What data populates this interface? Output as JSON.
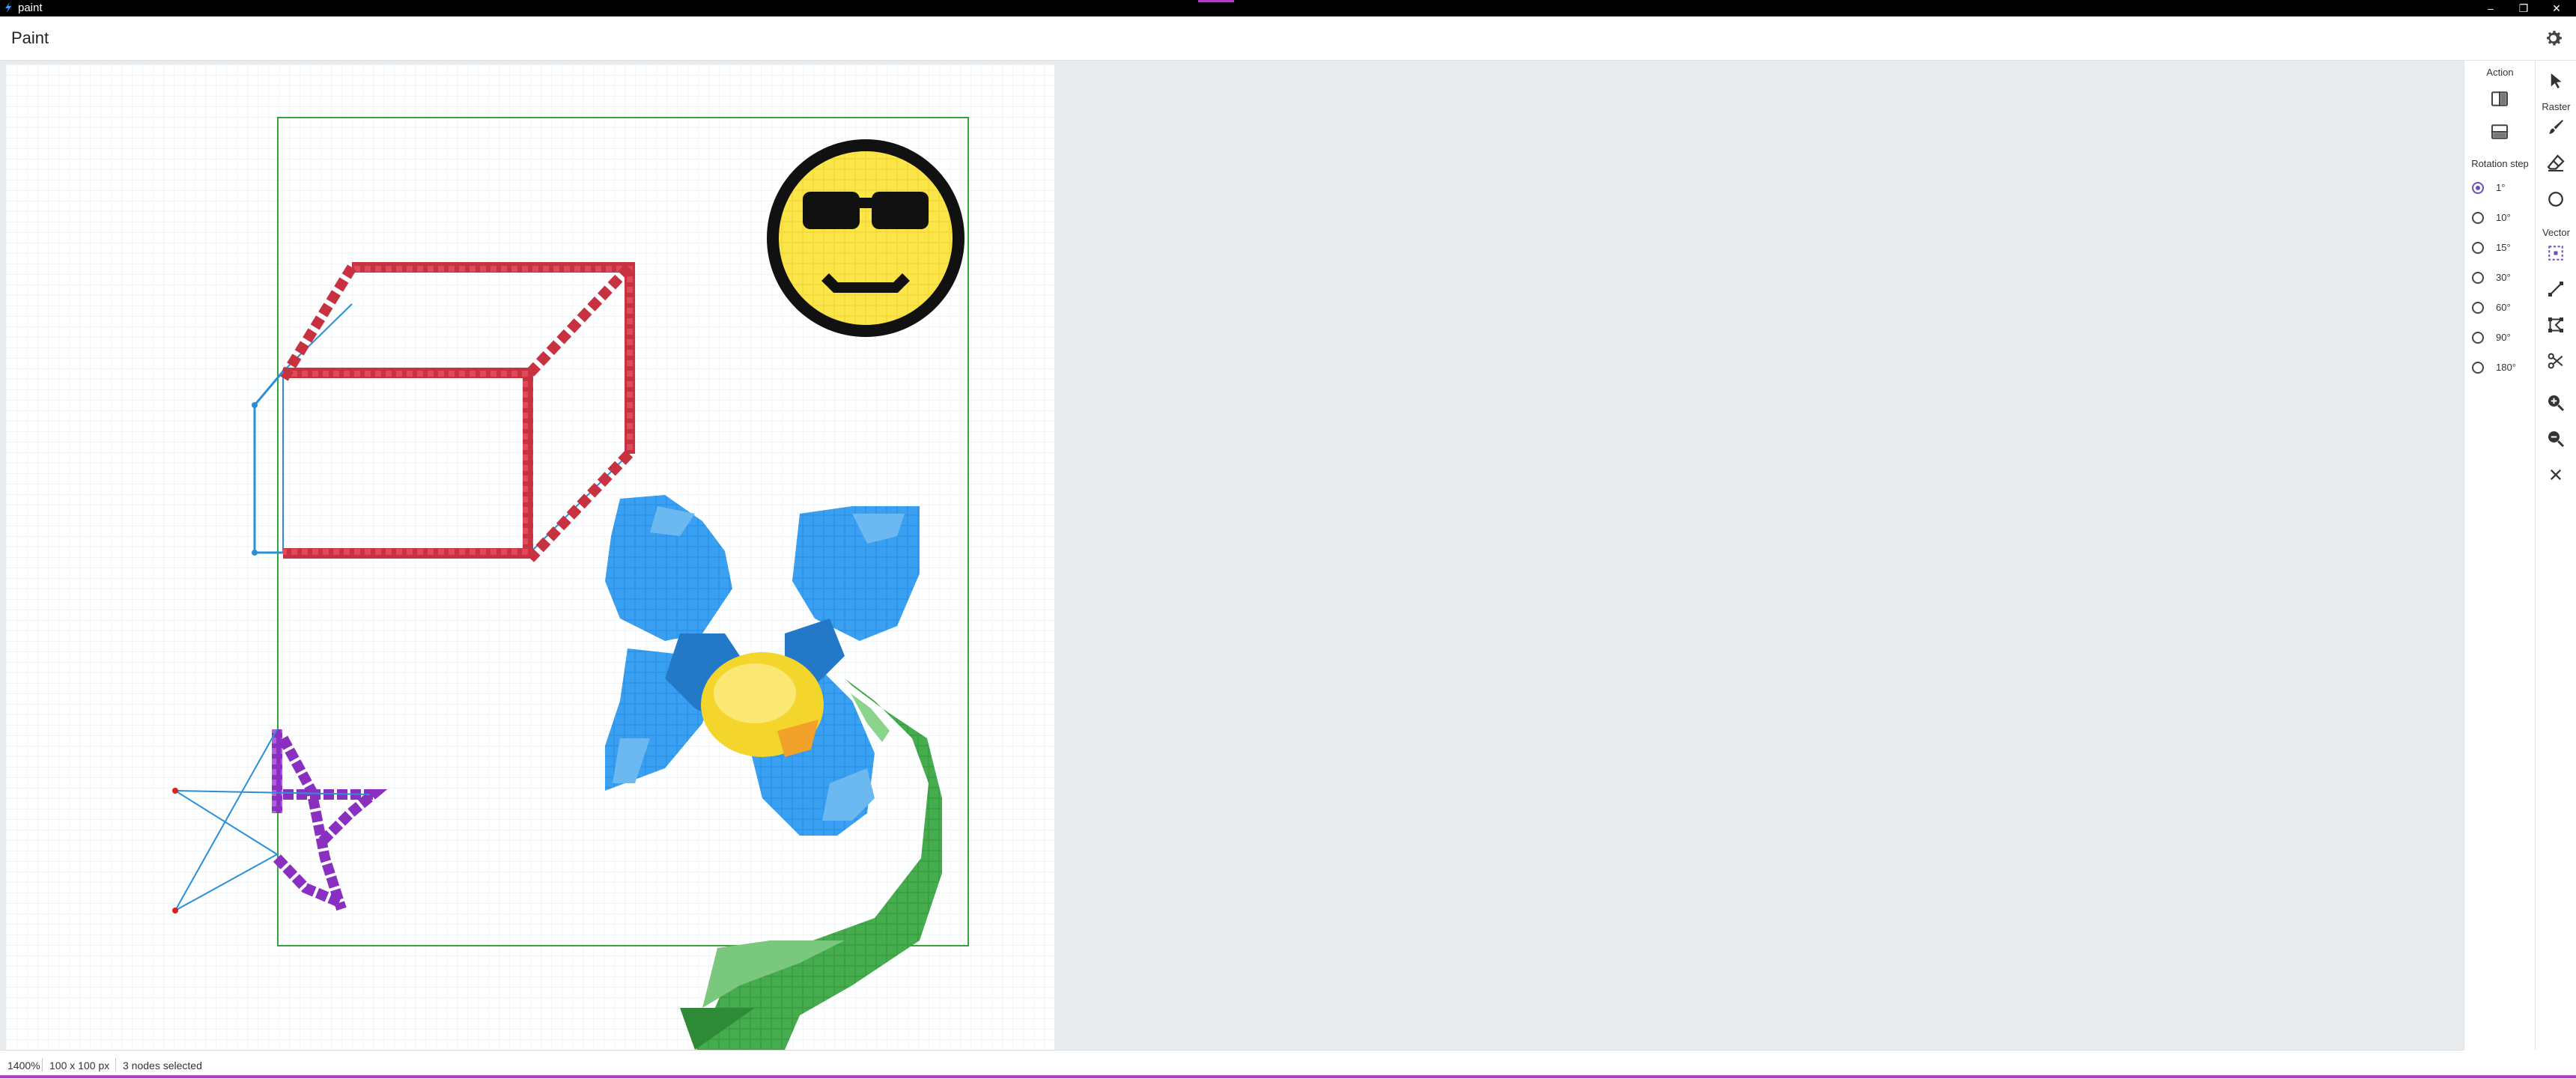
{
  "window": {
    "title": "paint"
  },
  "app": {
    "title": "Paint"
  },
  "status": {
    "zoom": "1400%",
    "size": "100 x 100 px",
    "selection": "3 nodes selected"
  },
  "panel": {
    "action_label": "Action",
    "rotation_label": "Rotation step",
    "rotation_options": [
      "1°",
      "10°",
      "15°",
      "30°",
      "60°",
      "90°",
      "180°"
    ],
    "rotation_selected": "1°"
  },
  "toolbar": {
    "raster_label": "Raster",
    "vector_label": "Vector"
  },
  "icons": {
    "window": [
      "app-logo-icon",
      "minimize-icon",
      "restore-icon",
      "close-icon"
    ],
    "appbar": [
      "settings-gear-icon"
    ],
    "actions": [
      "flip-horizontal-icon",
      "flip-vertical-icon"
    ],
    "tools": [
      "select-pointer-icon",
      "brush-icon",
      "eraser-icon",
      "circle-icon",
      "vector-select-icon",
      "line-icon",
      "node-edit-icon",
      "cut-icon",
      "zoom-in-icon",
      "zoom-out-icon",
      "close-icon"
    ]
  },
  "colors": {
    "accent": "#6b4fbb",
    "canvas_bg": "#ffffff",
    "workspace_bg": "#e9ecef",
    "selection_box": "#3aa23a",
    "vector_line": "#2a8fd8",
    "box_stroke": "#d23b4a",
    "star_stroke": "#9a3fd0",
    "node_handle": "#e02020"
  }
}
